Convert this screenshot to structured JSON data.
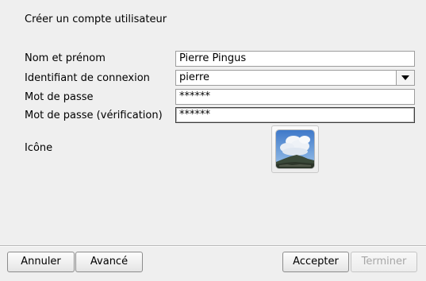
{
  "dialog": {
    "title": "Créer un compte utilisateur"
  },
  "form": {
    "full_name": {
      "label": "Nom et prénom",
      "value": "Pierre Pingus"
    },
    "login": {
      "label": "Identifiant de connexion",
      "value": "pierre",
      "icon": "chevron-down-icon"
    },
    "password": {
      "label": "Mot de passe",
      "value": "******"
    },
    "password_confirm": {
      "label": "Mot de passe (vérification)",
      "value": "******"
    },
    "icon": {
      "label": "Icône",
      "image": "landscape-avatar-icon"
    }
  },
  "buttons": {
    "cancel": "Annuler",
    "advanced": "Avancé",
    "accept": "Accepter",
    "finish": "Terminer"
  },
  "colors": {
    "background": "#efefef",
    "field_background": "#ffffff",
    "disabled_text": "#a6a6a6"
  }
}
